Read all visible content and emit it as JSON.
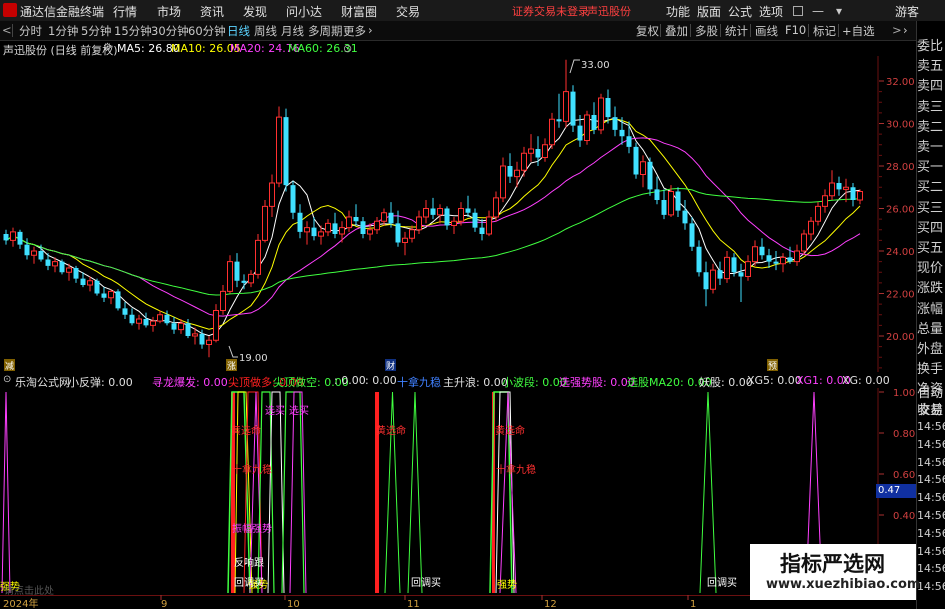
{
  "menubar": {
    "app_title": "通达信金融终端",
    "menus": [
      "行情",
      "市场",
      "资讯",
      "发现",
      "问小达",
      "财富圈",
      "交易"
    ],
    "warning": "证券交易未登录",
    "stock_name": "声迅股份",
    "right_menus": [
      "功能",
      "版面",
      "公式",
      "选项"
    ],
    "user": "游客"
  },
  "toolbar": {
    "periods": [
      "分时",
      "1分钟",
      "5分钟",
      "15分钟",
      "30分钟",
      "60分钟",
      "日线",
      "周线",
      "月线",
      "多周期",
      "更多"
    ],
    "active": "日线",
    "right_items": [
      "复权",
      "叠加",
      "多股",
      "统计",
      "画线",
      "F10",
      "标记",
      "+自选"
    ],
    "nav_left": "<",
    "nav_right": ">",
    "side_label": "L"
  },
  "ma_legend": {
    "title": "声迅股份 (日线 前复权)",
    "items": [
      {
        "label": "MA5: 26.80",
        "color": "#ffffff"
      },
      {
        "label": "MA10: 26.05",
        "color": "#ffff00"
      },
      {
        "label": "MA20: 24.76",
        "color": "#ff40ff"
      },
      {
        "label": "MA60: 26.31",
        "color": "#40ff40"
      }
    ]
  },
  "price_axis": [
    "32.00",
    "30.00",
    "28.00",
    "26.00",
    "24.00",
    "22.00",
    "20.00"
  ],
  "price_annotations": {
    "high": "33.00",
    "low": "19.00"
  },
  "event_markers": [
    "减",
    "涨",
    "财",
    "预"
  ],
  "indicator_legend": [
    {
      "label": "乐淘公式网",
      "color": "#e0e0e0"
    },
    {
      "label": "小反弹: 0.00",
      "color": "#e0e0e0"
    },
    {
      "label": "寻龙爆发: 0.00",
      "color": "#ff40ff"
    },
    {
      "label": "尖顶做多: 0.00",
      "color": "#ff2020"
    },
    {
      "label": "尖顶做空: 0.00",
      "color": "#40ff40"
    },
    {
      "label": ": 0.00",
      "color": "#e0e0e0"
    },
    {
      "label": ": 0.00",
      "color": "#e0e0e0"
    },
    {
      "label": "十拿九稳",
      "color": "#4080ff"
    },
    {
      "label": "主升浪: 0.00",
      "color": "#e0e0e0"
    },
    {
      "label": "小波段: 0.00",
      "color": "#40ff40"
    },
    {
      "label": "选强势股: 0.00",
      "color": "#ff40ff"
    },
    {
      "label": "选股MA20: 0.00",
      "color": "#40ff40"
    },
    {
      "label": "妖股: 0.00",
      "color": "#e0e0e0"
    },
    {
      "label": "XG5: 0.00",
      "color": "#e0e0e0"
    },
    {
      "label": "XG1: 0.00",
      "color": "#ff40ff"
    },
    {
      "label": "XG: 0.00",
      "color": "#e0e0e0"
    }
  ],
  "indicator_axis": [
    "1.00",
    "0.80",
    "0.60",
    "0.40",
    "0.20"
  ],
  "indicator_signals": [
    "黄选命",
    "黄选命",
    "黄选命",
    "选买",
    "选买",
    "十拿九稳",
    "十拿九稳",
    "强势",
    "强势",
    "回调买",
    "回调买",
    "回调买",
    "反响跟",
    "强势"
  ],
  "time_axis": [
    "2024年",
    "9",
    "10",
    "11",
    "12",
    "1"
  ],
  "side_panel": {
    "quote_rows": [
      "委比",
      "卖五",
      "卖四",
      "卖三",
      "卖二",
      "卖一",
      "买一",
      "买二",
      "买三",
      "买四",
      "买五",
      "现价",
      "涨跌",
      "涨幅",
      "总量",
      "外盘",
      "换手",
      "净资",
      "收益"
    ],
    "right_labels": [
      "自动",
      "交易"
    ],
    "times": [
      "14:56",
      "14:56",
      "14:56",
      "14:56",
      "14:56",
      "14:56",
      "14:56",
      "14:56",
      "14:56",
      "14:56"
    ],
    "value_box": "0.47"
  },
  "status_footer": "请点击此处",
  "watermark": {
    "title": "指标严选网",
    "url": "www.xuezhibiao.com"
  },
  "colors": {
    "up": "#ff3030",
    "down": "#40e0ff",
    "ma5": "#ffffff",
    "ma10": "#ffff00",
    "ma20": "#ff40ff",
    "ma60": "#40ff40"
  },
  "chart_data": {
    "type": "candlestick",
    "title": "声迅股份 (日线 前复权)",
    "y_range": [
      19.0,
      33.0
    ],
    "candles_ohlc": [
      [
        24.8,
        25.0,
        24.3,
        24.5
      ],
      [
        24.5,
        25.1,
        24.2,
        24.9
      ],
      [
        24.9,
        25.0,
        24.1,
        24.3
      ],
      [
        24.3,
        24.6,
        23.6,
        23.8
      ],
      [
        23.8,
        24.2,
        23.4,
        24.0
      ],
      [
        24.0,
        24.3,
        23.5,
        23.6
      ],
      [
        23.6,
        23.9,
        23.1,
        23.3
      ],
      [
        23.3,
        23.7,
        23.0,
        23.5
      ],
      [
        23.5,
        23.6,
        22.9,
        23.0
      ],
      [
        23.0,
        23.4,
        22.6,
        23.2
      ],
      [
        23.2,
        23.3,
        22.5,
        22.7
      ],
      [
        22.7,
        23.0,
        22.3,
        22.4
      ],
      [
        22.4,
        22.8,
        22.1,
        22.6
      ],
      [
        22.6,
        22.7,
        21.9,
        22.0
      ],
      [
        22.0,
        22.3,
        21.6,
        21.8
      ],
      [
        21.8,
        22.2,
        21.5,
        22.1
      ],
      [
        22.1,
        22.2,
        21.2,
        21.3
      ],
      [
        21.3,
        21.6,
        20.8,
        21.0
      ],
      [
        21.0,
        21.3,
        20.5,
        20.6
      ],
      [
        20.6,
        21.0,
        20.3,
        20.8
      ],
      [
        20.8,
        21.1,
        20.4,
        20.5
      ],
      [
        20.5,
        20.9,
        20.2,
        20.7
      ],
      [
        20.7,
        21.2,
        20.6,
        21.0
      ],
      [
        21.0,
        21.2,
        20.5,
        20.6
      ],
      [
        20.6,
        20.9,
        20.1,
        20.3
      ],
      [
        20.3,
        20.8,
        20.1,
        20.6
      ],
      [
        20.6,
        20.8,
        19.9,
        20.0
      ],
      [
        20.0,
        20.4,
        19.6,
        20.1
      ],
      [
        20.1,
        20.3,
        19.4,
        19.6
      ],
      [
        19.6,
        20.0,
        19.0,
        19.8
      ],
      [
        19.8,
        21.5,
        19.7,
        21.2
      ],
      [
        21.2,
        22.4,
        21.0,
        22.1
      ],
      [
        22.1,
        23.8,
        22.0,
        23.5
      ],
      [
        23.5,
        23.9,
        22.3,
        22.6
      ],
      [
        22.6,
        22.9,
        22.2,
        22.5
      ],
      [
        22.5,
        23.1,
        22.3,
        22.9
      ],
      [
        22.9,
        24.8,
        22.7,
        24.5
      ],
      [
        24.5,
        26.4,
        24.4,
        26.1
      ],
      [
        26.1,
        27.6,
        25.6,
        27.2
      ],
      [
        27.2,
        30.8,
        27.0,
        30.3
      ],
      [
        30.3,
        30.7,
        26.8,
        27.1
      ],
      [
        27.1,
        27.3,
        25.5,
        25.8
      ],
      [
        25.8,
        26.2,
        24.6,
        24.9
      ],
      [
        24.9,
        25.4,
        24.3,
        25.1
      ],
      [
        25.1,
        25.6,
        24.5,
        24.7
      ],
      [
        24.7,
        25.2,
        24.3,
        24.9
      ],
      [
        24.9,
        25.5,
        24.7,
        25.3
      ],
      [
        25.3,
        25.8,
        24.6,
        24.8
      ],
      [
        24.8,
        25.4,
        24.4,
        25.1
      ],
      [
        25.1,
        25.9,
        24.9,
        25.6
      ],
      [
        25.6,
        26.2,
        25.2,
        25.4
      ],
      [
        25.4,
        25.6,
        24.6,
        24.8
      ],
      [
        24.8,
        25.3,
        24.5,
        25.0
      ],
      [
        25.0,
        25.6,
        24.8,
        25.4
      ],
      [
        25.4,
        26.0,
        25.2,
        25.8
      ],
      [
        25.8,
        26.3,
        25.1,
        25.3
      ],
      [
        25.3,
        25.9,
        24.2,
        24.4
      ],
      [
        24.4,
        24.9,
        23.8,
        24.6
      ],
      [
        24.6,
        25.2,
        24.4,
        25.0
      ],
      [
        25.0,
        25.9,
        24.8,
        25.6
      ],
      [
        25.6,
        26.4,
        25.3,
        26.0
      ],
      [
        26.0,
        26.5,
        25.5,
        25.7
      ],
      [
        25.7,
        26.2,
        25.3,
        26.0
      ],
      [
        26.0,
        26.1,
        25.0,
        25.2
      ],
      [
        25.2,
        25.6,
        24.8,
        25.4
      ],
      [
        25.4,
        26.3,
        25.2,
        26.0
      ],
      [
        26.0,
        26.6,
        25.6,
        25.8
      ],
      [
        25.8,
        26.0,
        24.9,
        25.1
      ],
      [
        25.1,
        25.5,
        24.5,
        24.8
      ],
      [
        24.8,
        25.9,
        24.7,
        25.6
      ],
      [
        25.6,
        26.8,
        25.4,
        26.5
      ],
      [
        26.5,
        28.4,
        26.3,
        28.0
      ],
      [
        28.0,
        28.6,
        27.2,
        27.5
      ],
      [
        27.5,
        28.2,
        27.0,
        27.8
      ],
      [
        27.8,
        28.9,
        27.5,
        28.6
      ],
      [
        28.6,
        29.5,
        28.2,
        28.8
      ],
      [
        28.8,
        29.4,
        28.0,
        28.4
      ],
      [
        28.4,
        29.3,
        28.2,
        29.0
      ],
      [
        29.0,
        30.5,
        28.8,
        30.2
      ],
      [
        30.2,
        31.4,
        29.8,
        30.1
      ],
      [
        30.1,
        33.0,
        29.8,
        31.5
      ],
      [
        31.5,
        31.8,
        29.6,
        29.9
      ],
      [
        29.9,
        30.4,
        28.9,
        29.2
      ],
      [
        29.2,
        30.6,
        29.0,
        30.4
      ],
      [
        30.4,
        31.0,
        29.5,
        29.7
      ],
      [
        29.7,
        31.4,
        29.5,
        31.2
      ],
      [
        31.2,
        31.6,
        30.0,
        30.3
      ],
      [
        30.3,
        30.8,
        29.4,
        29.7
      ],
      [
        29.7,
        30.3,
        29.0,
        29.4
      ],
      [
        29.4,
        30.1,
        28.6,
        28.9
      ],
      [
        28.9,
        29.1,
        27.4,
        27.6
      ],
      [
        27.6,
        28.5,
        27.0,
        28.2
      ],
      [
        28.2,
        28.4,
        26.6,
        26.9
      ],
      [
        26.9,
        27.5,
        26.2,
        26.4
      ],
      [
        26.4,
        26.9,
        25.5,
        25.7
      ],
      [
        25.7,
        27.1,
        25.6,
        26.8
      ],
      [
        26.8,
        27.0,
        25.6,
        25.9
      ],
      [
        25.9,
        26.4,
        25.0,
        25.3
      ],
      [
        25.3,
        25.6,
        24.0,
        24.2
      ],
      [
        24.2,
        24.5,
        22.8,
        23.0
      ],
      [
        23.0,
        23.5,
        21.4,
        22.2
      ],
      [
        22.2,
        23.4,
        22.0,
        23.1
      ],
      [
        23.1,
        23.5,
        22.4,
        22.7
      ],
      [
        22.7,
        24.0,
        22.5,
        23.7
      ],
      [
        23.7,
        23.9,
        22.8,
        23.0
      ],
      [
        23.0,
        23.4,
        21.6,
        22.8
      ],
      [
        22.8,
        23.8,
        22.6,
        23.5
      ],
      [
        23.5,
        24.5,
        23.3,
        24.2
      ],
      [
        24.2,
        24.6,
        23.6,
        23.8
      ],
      [
        23.8,
        24.1,
        23.2,
        23.5
      ],
      [
        23.5,
        24.0,
        23.1,
        23.4
      ],
      [
        23.4,
        23.9,
        23.0,
        23.7
      ],
      [
        23.7,
        24.2,
        23.4,
        23.5
      ],
      [
        23.5,
        24.3,
        23.3,
        24.0
      ],
      [
        24.0,
        25.0,
        23.8,
        24.8
      ],
      [
        24.8,
        25.6,
        24.5,
        25.4
      ],
      [
        25.4,
        26.3,
        25.2,
        26.1
      ],
      [
        26.1,
        26.9,
        25.8,
        26.6
      ],
      [
        26.6,
        27.8,
        26.4,
        27.2
      ],
      [
        27.2,
        27.5,
        26.6,
        26.9
      ],
      [
        26.9,
        27.4,
        26.3,
        27.0
      ],
      [
        27.0,
        27.2,
        26.1,
        26.4
      ],
      [
        26.4,
        26.9,
        26.2,
        26.8
      ]
    ]
  }
}
